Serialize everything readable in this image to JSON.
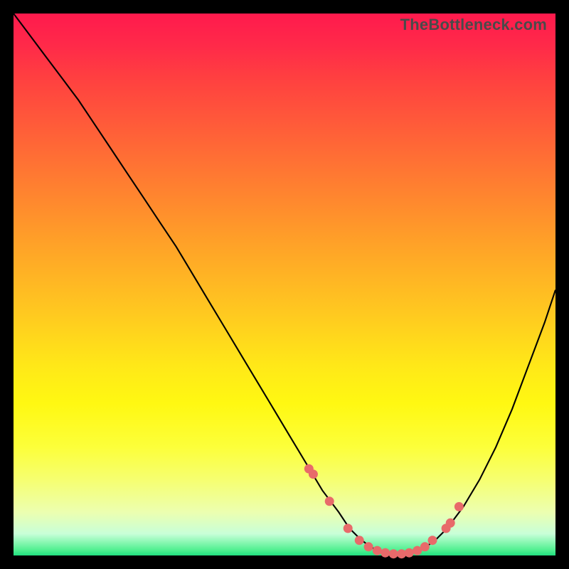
{
  "watermark": "TheBottleneck.com",
  "chart_data": {
    "type": "line",
    "title": "",
    "xlabel": "",
    "ylabel": "",
    "xlim": [
      0,
      100
    ],
    "ylim": [
      0,
      100
    ],
    "series": [
      {
        "name": "bottleneck-curve",
        "x": [
          0,
          3,
          6,
          9,
          12,
          15,
          18,
          21,
          24,
          27,
          30,
          33,
          36,
          39,
          42,
          45,
          48,
          51,
          54,
          57,
          60,
          62,
          64,
          66,
          68,
          70,
          72,
          74,
          76,
          78,
          80,
          83,
          86,
          89,
          92,
          95,
          98,
          100
        ],
        "values": [
          100,
          96,
          92,
          88,
          84,
          79.5,
          75,
          70.5,
          66,
          61.5,
          57,
          52,
          47,
          42,
          37,
          32,
          27,
          22,
          17,
          12,
          8,
          5,
          3,
          1.5,
          0.7,
          0.3,
          0.3,
          0.7,
          1.5,
          3,
          5,
          9,
          14,
          20,
          27,
          35,
          43,
          49
        ]
      }
    ],
    "markers": {
      "name": "highlight-dots",
      "x": [
        54.5,
        55.3,
        58.3,
        61.7,
        63.8,
        65.5,
        67.1,
        68.6,
        70.1,
        71.6,
        73.0,
        74.5,
        75.9,
        77.3,
        79.8,
        80.6,
        82.2
      ],
      "y": [
        16.0,
        15.0,
        10.0,
        5.0,
        2.8,
        1.6,
        0.9,
        0.5,
        0.3,
        0.3,
        0.5,
        0.9,
        1.6,
        2.8,
        5.0,
        6.0,
        9.0
      ]
    }
  }
}
